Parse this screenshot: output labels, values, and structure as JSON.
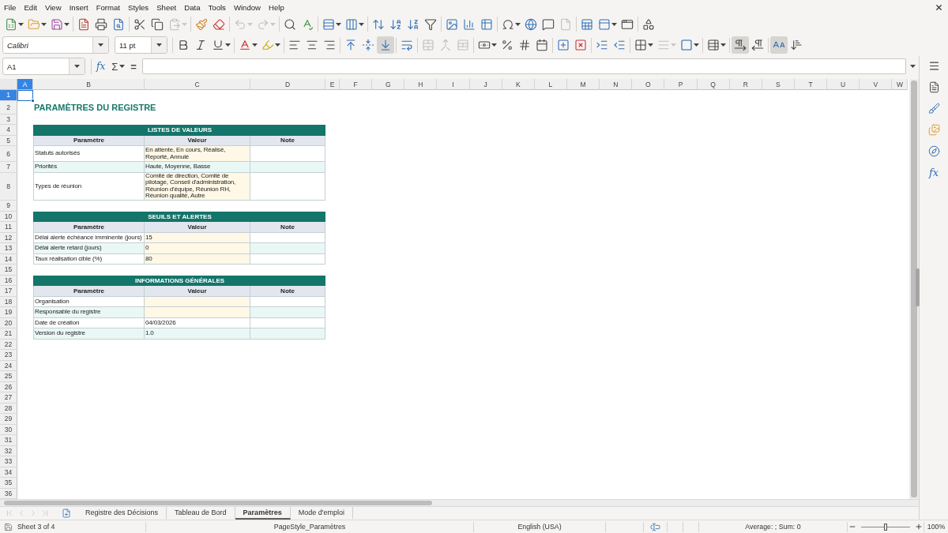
{
  "menu_bar": {
    "items": [
      "File",
      "Edit",
      "View",
      "Insert",
      "Format",
      "Styles",
      "Sheet",
      "Data",
      "Tools",
      "Window",
      "Help"
    ]
  },
  "standard_toolbar": {
    "groups": [
      {
        "buttons": [
          {
            "pressed": false,
            "disabled": false
          },
          {
            "pressed": false,
            "disabled": false
          },
          {
            "pressed": false,
            "disabled": false
          }
        ]
      },
      {
        "buttons": [
          {
            "pressed": false,
            "disabled": false
          },
          {
            "pressed": false,
            "disabled": false
          },
          {
            "pressed": false,
            "disabled": false
          }
        ]
      },
      {
        "buttons": [
          {
            "pressed": false,
            "disabled": false
          },
          {
            "pressed": false,
            "disabled": false
          },
          {
            "pressed": false,
            "disabled": true
          }
        ]
      },
      {
        "buttons": [
          {
            "pressed": false,
            "disabled": false
          },
          {
            "pressed": false,
            "disabled": false
          }
        ]
      },
      {
        "buttons": [
          {
            "pressed": false,
            "disabled": true
          },
          {
            "pressed": false,
            "disabled": true
          }
        ]
      },
      {
        "buttons": [
          {
            "pressed": false,
            "disabled": false
          },
          {
            "pressed": false,
            "disabled": false
          }
        ]
      },
      {
        "buttons": [
          {
            "pressed": false,
            "disabled": false
          },
          {
            "pressed": false,
            "disabled": false
          }
        ]
      },
      {
        "buttons": [
          {
            "pressed": false,
            "disabled": false
          },
          {
            "pressed": false,
            "disabled": false
          },
          {
            "pressed": false,
            "disabled": false
          },
          {
            "pressed": false,
            "disabled": false
          }
        ]
      },
      {
        "buttons": [
          {
            "pressed": false,
            "disabled": false
          },
          {
            "pressed": false,
            "disabled": false
          },
          {
            "pressed": false,
            "disabled": false
          }
        ]
      },
      {
        "buttons": [
          {
            "pressed": false,
            "disabled": false
          },
          {
            "pressed": false,
            "disabled": false
          },
          {
            "pressed": false,
            "disabled": false
          },
          {
            "pressed": false,
            "disabled": true
          }
        ]
      },
      {
        "buttons": [
          {
            "pressed": false,
            "disabled": false
          },
          {
            "pressed": false,
            "disabled": false
          },
          {
            "pressed": false,
            "disabled": false
          }
        ]
      },
      {
        "buttons": [
          {
            "pressed": false,
            "disabled": false
          }
        ]
      }
    ]
  },
  "formatting_toolbar": {
    "font_name": "Calibri",
    "font_size": "11 pt",
    "groups": [
      {
        "buttons": [
          {
            "pressed": false,
            "disabled": false
          },
          {
            "pressed": false,
            "disabled": false
          },
          {
            "pressed": false,
            "disabled": false
          }
        ]
      },
      {
        "buttons": [
          {
            "pressed": false,
            "disabled": false
          },
          {
            "pressed": false,
            "disabled": false
          }
        ]
      },
      {
        "buttons": [
          {
            "pressed": false,
            "disabled": false
          },
          {
            "pressed": false,
            "disabled": false
          },
          {
            "pressed": false,
            "disabled": false
          }
        ]
      },
      {
        "buttons": [
          {
            "pressed": false,
            "disabled": false
          },
          {
            "pressed": false,
            "disabled": false
          },
          {
            "pressed": true,
            "disabled": false
          }
        ]
      },
      {
        "buttons": [
          {
            "pressed": false,
            "disabled": false
          }
        ]
      },
      {
        "buttons": [
          {
            "pressed": false,
            "disabled": true
          },
          {
            "pressed": false,
            "disabled": true
          },
          {
            "pressed": false,
            "disabled": true
          }
        ]
      },
      {
        "buttons": [
          {
            "pressed": false,
            "disabled": false
          },
          {
            "pressed": false,
            "disabled": false
          },
          {
            "pressed": false,
            "disabled": false
          },
          {
            "pressed": false,
            "disabled": false
          }
        ]
      },
      {
        "buttons": [
          {
            "pressed": false,
            "disabled": false
          },
          {
            "pressed": false,
            "disabled": false
          }
        ]
      },
      {
        "buttons": [
          {
            "pressed": false,
            "disabled": false
          },
          {
            "pressed": false,
            "disabled": false
          }
        ]
      },
      {
        "buttons": [
          {
            "pressed": false,
            "disabled": false
          },
          {
            "pressed": false,
            "disabled": true
          },
          {
            "pressed": false,
            "disabled": false
          }
        ]
      },
      {
        "buttons": [
          {
            "pressed": false,
            "disabled": false
          }
        ]
      },
      {
        "buttons": [
          {
            "pressed": true,
            "disabled": false
          },
          {
            "pressed": false,
            "disabled": false
          }
        ]
      },
      {
        "buttons": [
          {
            "pressed": true,
            "disabled": false
          },
          {
            "pressed": false,
            "disabled": false
          }
        ]
      }
    ]
  },
  "formula_bar": {
    "name_box": "A1",
    "function_wizard": "fx",
    "sum": "Σ",
    "equals": "="
  },
  "sidebar": {
    "functions": "fx"
  },
  "sheet": {
    "columns": [
      {
        "label": "A",
        "selected": true
      },
      {
        "label": "B",
        "selected": false
      },
      {
        "label": "C",
        "selected": false
      },
      {
        "label": "D",
        "selected": false
      },
      {
        "label": "E",
        "selected": false
      },
      {
        "label": "F",
        "selected": false
      },
      {
        "label": "G",
        "selected": false
      },
      {
        "label": "H",
        "selected": false
      },
      {
        "label": "I",
        "selected": false
      },
      {
        "label": "J",
        "selected": false
      },
      {
        "label": "K",
        "selected": false
      },
      {
        "label": "L",
        "selected": false
      },
      {
        "label": "M",
        "selected": false
      },
      {
        "label": "N",
        "selected": false
      },
      {
        "label": "O",
        "selected": false
      },
      {
        "label": "P",
        "selected": false
      },
      {
        "label": "Q",
        "selected": false
      },
      {
        "label": "R",
        "selected": false
      },
      {
        "label": "S",
        "selected": false
      },
      {
        "label": "T",
        "selected": false
      },
      {
        "label": "U",
        "selected": false
      },
      {
        "label": "V",
        "selected": false
      },
      {
        "label": "W",
        "selected": false
      }
    ],
    "rows": [
      {
        "label": "1",
        "selected": true
      },
      {
        "label": "2",
        "selected": false
      },
      {
        "label": "3",
        "selected": false
      },
      {
        "label": "4",
        "selected": false
      },
      {
        "label": "5",
        "selected": false
      },
      {
        "label": "6",
        "selected": false
      },
      {
        "label": "7",
        "selected": false
      },
      {
        "label": "8",
        "selected": false
      },
      {
        "label": "9",
        "selected": false
      },
      {
        "label": "10",
        "selected": false
      },
      {
        "label": "11",
        "selected": false
      },
      {
        "label": "12",
        "selected": false
      },
      {
        "label": "13",
        "selected": false
      },
      {
        "label": "14",
        "selected": false
      },
      {
        "label": "15",
        "selected": false
      },
      {
        "label": "16",
        "selected": false
      },
      {
        "label": "17",
        "selected": false
      },
      {
        "label": "18",
        "selected": false
      },
      {
        "label": "19",
        "selected": false
      },
      {
        "label": "20",
        "selected": false
      },
      {
        "label": "21",
        "selected": false
      },
      {
        "label": "22",
        "selected": false
      },
      {
        "label": "23",
        "selected": false
      },
      {
        "label": "24",
        "selected": false
      },
      {
        "label": "25",
        "selected": false
      },
      {
        "label": "26",
        "selected": false
      },
      {
        "label": "27",
        "selected": false
      },
      {
        "label": "28",
        "selected": false
      },
      {
        "label": "29",
        "selected": false
      },
      {
        "label": "30",
        "selected": false
      },
      {
        "label": "31",
        "selected": false
      },
      {
        "label": "32",
        "selected": false
      },
      {
        "label": "33",
        "selected": false
      },
      {
        "label": "34",
        "selected": false
      },
      {
        "label": "35",
        "selected": false
      },
      {
        "label": "36",
        "selected": false
      }
    ],
    "title": "PARAMÈTRES DU REGISTRE",
    "tables": [
      {
        "title": "LISTES DE VALEURS",
        "headers": [
          "Paramètre",
          "Valeur",
          "Note"
        ],
        "rows": [
          {
            "parameter": "Statuts autorisés",
            "value": "En attente, En cours, Réalisé, Reporté, Annulé",
            "striped": false,
            "value_highlighted": true
          },
          {
            "parameter": "Priorités",
            "value": "Haute, Moyenne, Basse",
            "striped": true,
            "value_highlighted": false
          },
          {
            "parameter": "Types de réunion",
            "value": "Comité de direction, Comité de pilotage, Conseil d'administration, Réunion d'équipe, Réunion RH, Réunion qualité, Autre",
            "striped": false,
            "value_highlighted": true
          }
        ]
      },
      {
        "title": "SEUILS ET ALERTES",
        "headers": [
          "Paramètre",
          "Valeur",
          "Note"
        ],
        "rows": [
          {
            "parameter": "Délai alerte échéance imminente (jours)",
            "value": "15",
            "striped": false,
            "value_highlighted": true
          },
          {
            "parameter": "Délai alerte retard (jours)",
            "value": "0",
            "striped": true,
            "value_highlighted": true
          },
          {
            "parameter": "Taux réalisation cible (%)",
            "value": "80",
            "striped": false,
            "value_highlighted": true
          }
        ]
      },
      {
        "title": "INFORMATIONS GÉNÉRALES",
        "headers": [
          "Paramètre",
          "Valeur",
          "Note"
        ],
        "rows": [
          {
            "parameter": "Organisation",
            "striped": false,
            "value_highlighted": true
          },
          {
            "parameter": "Responsable du registre",
            "striped": true,
            "value_highlighted": true
          },
          {
            "parameter": "Date de création",
            "value": "04/03/2026",
            "striped": false,
            "value_highlighted": false
          },
          {
            "parameter": "Version du registre",
            "value": "1.0",
            "striped": true,
            "value_highlighted": false
          }
        ]
      }
    ]
  },
  "sheet_tabs": {
    "nav_buttons": [
      {
        "disabled": true
      },
      {
        "disabled": true
      },
      {
        "disabled": true
      },
      {
        "disabled": true
      }
    ],
    "tabs": [
      {
        "label": "Registre des Décisions",
        "selected": false
      },
      {
        "label": "Tableau de Bord",
        "selected": false
      },
      {
        "label": "Paramètres",
        "selected": true
      },
      {
        "label": "Mode d'emploi",
        "selected": false
      }
    ]
  },
  "status_bar": {
    "sheet_position": "Sheet 3 of 4",
    "page_style": "PageStyle_Paramètres",
    "language": "English (USA)",
    "selection_stats": "Average: ; Sum: 0",
    "zoom": {
      "level": 0.5,
      "reading": "100%"
    }
  }
}
